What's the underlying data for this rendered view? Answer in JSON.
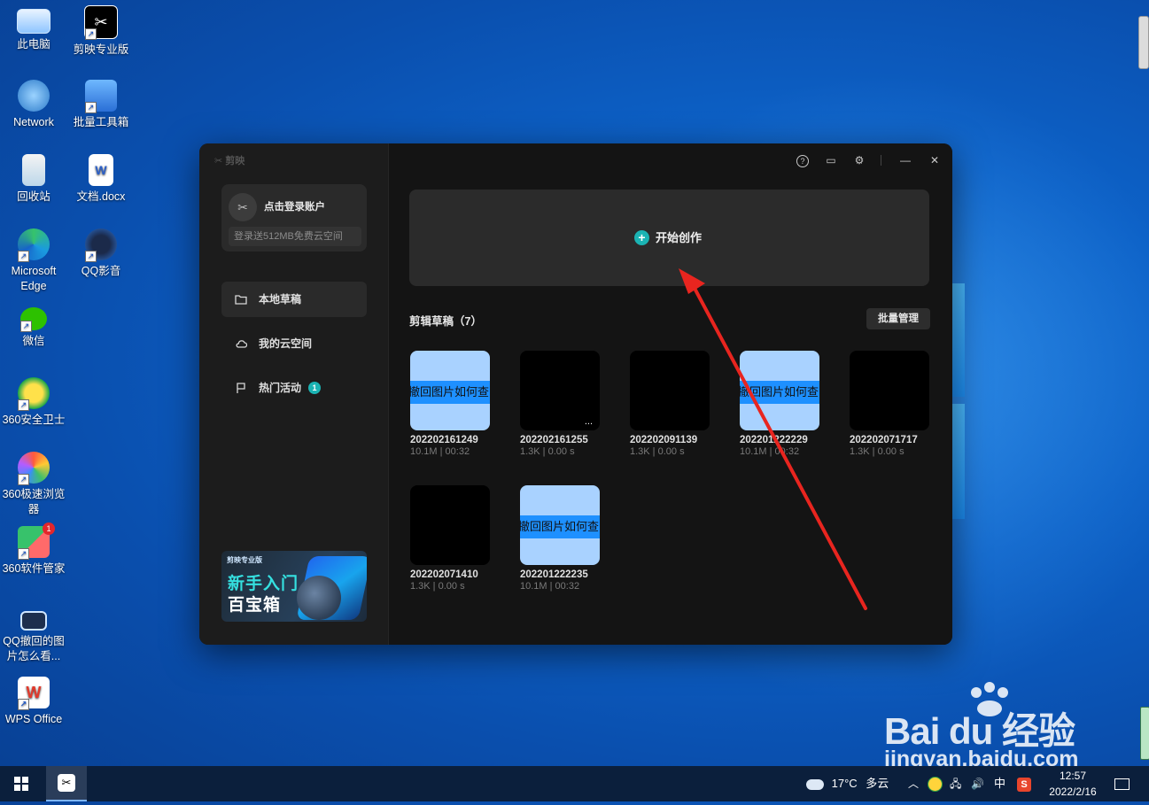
{
  "desktop": {
    "icons": [
      {
        "label": "此电脑",
        "icon": "computer-icon"
      },
      {
        "label": "剪映专业版",
        "icon": "capcut-icon"
      },
      {
        "label": "Network",
        "icon": "network-icon"
      },
      {
        "label": "批量工具箱",
        "icon": "toolbox-icon"
      },
      {
        "label": "回收站",
        "icon": "recycle-bin-icon"
      },
      {
        "label": "文档.docx",
        "icon": "word-document-icon"
      },
      {
        "label": "Microsoft Edge",
        "icon": "edge-icon"
      },
      {
        "label": "QQ影音",
        "icon": "qq-player-icon"
      },
      {
        "label": "微信",
        "icon": "wechat-icon"
      },
      {
        "label": "360安全卫士",
        "icon": "360-security-icon"
      },
      {
        "label": "360极速浏览器",
        "icon": "360-browser-icon"
      },
      {
        "label": "360软件管家",
        "icon": "360-software-icon"
      },
      {
        "label": "QQ撤回的图片怎么看...",
        "icon": "video-file-icon"
      },
      {
        "label": "WPS Office",
        "icon": "wps-icon"
      }
    ],
    "notification_badge": "1"
  },
  "app": {
    "brand": "剪映",
    "login": {
      "avatar": "✂",
      "title": "点击登录账户",
      "subtitle": "登录送512MB免费云空间"
    },
    "nav": [
      {
        "label": "本地草稿",
        "icon": "folder-icon"
      },
      {
        "label": "我的云空间",
        "icon": "cloud-icon"
      },
      {
        "label": "热门活动",
        "icon": "flag-icon",
        "badge": "1"
      }
    ],
    "banner": {
      "small": "剪映专业版",
      "line1": "新手入门",
      "line2": "百宝箱"
    },
    "start_label": "开始创作",
    "section_title": "剪辑草稿（7）",
    "batch_label": "批量管理",
    "drafts": [
      {
        "name": "202202161249",
        "meta": "10.1M | 00:32",
        "thumb": "light",
        "thumb_text": "撤回图片如何查"
      },
      {
        "name": "202202161255",
        "meta": "1.3K | 0.00 s",
        "thumb": "dark",
        "thumb_text": "..."
      },
      {
        "name": "202202091139",
        "meta": "1.3K | 0.00 s",
        "thumb": "dark",
        "thumb_text": ""
      },
      {
        "name": "202201222229",
        "meta": "10.1M | 00:32",
        "thumb": "light",
        "thumb_text": "撤回图片如何查"
      },
      {
        "name": "202202071717",
        "meta": "1.3K | 0.00 s",
        "thumb": "dark",
        "thumb_text": ""
      },
      {
        "name": "202202071410",
        "meta": "1.3K | 0.00 s",
        "thumb": "dark",
        "thumb_text": ""
      },
      {
        "name": "202201222235",
        "meta": "10.1M | 00:32",
        "thumb": "light",
        "thumb_text": "撤回图片如何查"
      }
    ],
    "controls": {
      "help": "?",
      "feedback": "▭",
      "settings": "⚙",
      "minimize": "—",
      "close": "✕"
    }
  },
  "watermark": {
    "logo": "Bai du 经验",
    "url": "jingyan.baidu.com"
  },
  "taskbar": {
    "weather_temp": "17°C",
    "weather_text": "多云",
    "ime": "中",
    "time": "12:57",
    "date": "2022/2/16"
  },
  "colors": {
    "accent": "#1bb3b3",
    "annotation_arrow": "#e8251f"
  }
}
